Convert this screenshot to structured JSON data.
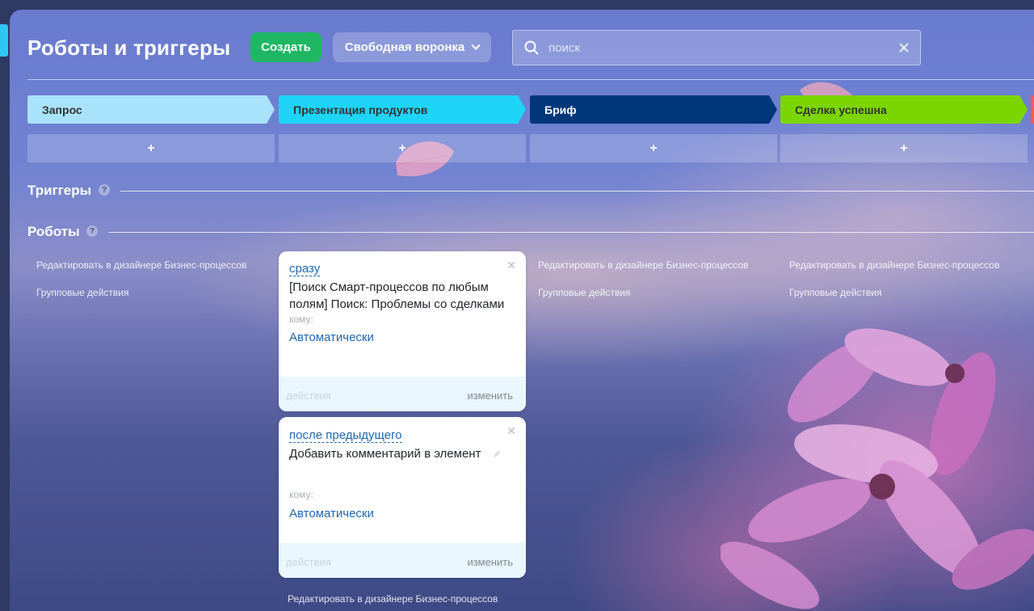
{
  "header": {
    "title": "Роботы и триггеры",
    "create_label": "Создать",
    "funnel_label": "Свободная воронка",
    "search_placeholder": "поиск"
  },
  "stages": [
    {
      "label": "Запрос",
      "color": "#a9e2fb",
      "text_color": "#333333"
    },
    {
      "label": "Презентация продуктов",
      "color": "#1ed4f7",
      "text_color": "#333333"
    },
    {
      "label": "Бриф",
      "color": "#00377a",
      "text_color": "#ffffff"
    },
    {
      "label": "Сделка успешна",
      "color": "#7bd500",
      "text_color": "#333333"
    }
  ],
  "add_symbol": "+",
  "sections": {
    "triggers": "Триггеры",
    "robots": "Роботы",
    "help_symbol": "?"
  },
  "column_links": {
    "edit_designer": "Редактировать в дизайнере Бизнес-процессов",
    "group_actions": "Групповые действия"
  },
  "robots": [
    {
      "condition": "сразу",
      "title": "[Поиск Смарт-процессов по любым полям] Поиск: Проблемы со сделками",
      "to_label": "кому:",
      "to_value": "Автоматически",
      "actions_label": "действия",
      "edit_label": "изменить"
    },
    {
      "condition": "после предыдущего",
      "title": "Добавить комментарий в элемент",
      "to_label": "кому:",
      "to_value": "Автоматически",
      "actions_label": "действия",
      "edit_label": "изменить"
    }
  ],
  "icons": {
    "search": "search-icon",
    "clear": "close-icon",
    "dropdown": "chevron-down-icon",
    "card_close": "close-icon",
    "edit": "pencil-icon",
    "help": "help-icon"
  }
}
